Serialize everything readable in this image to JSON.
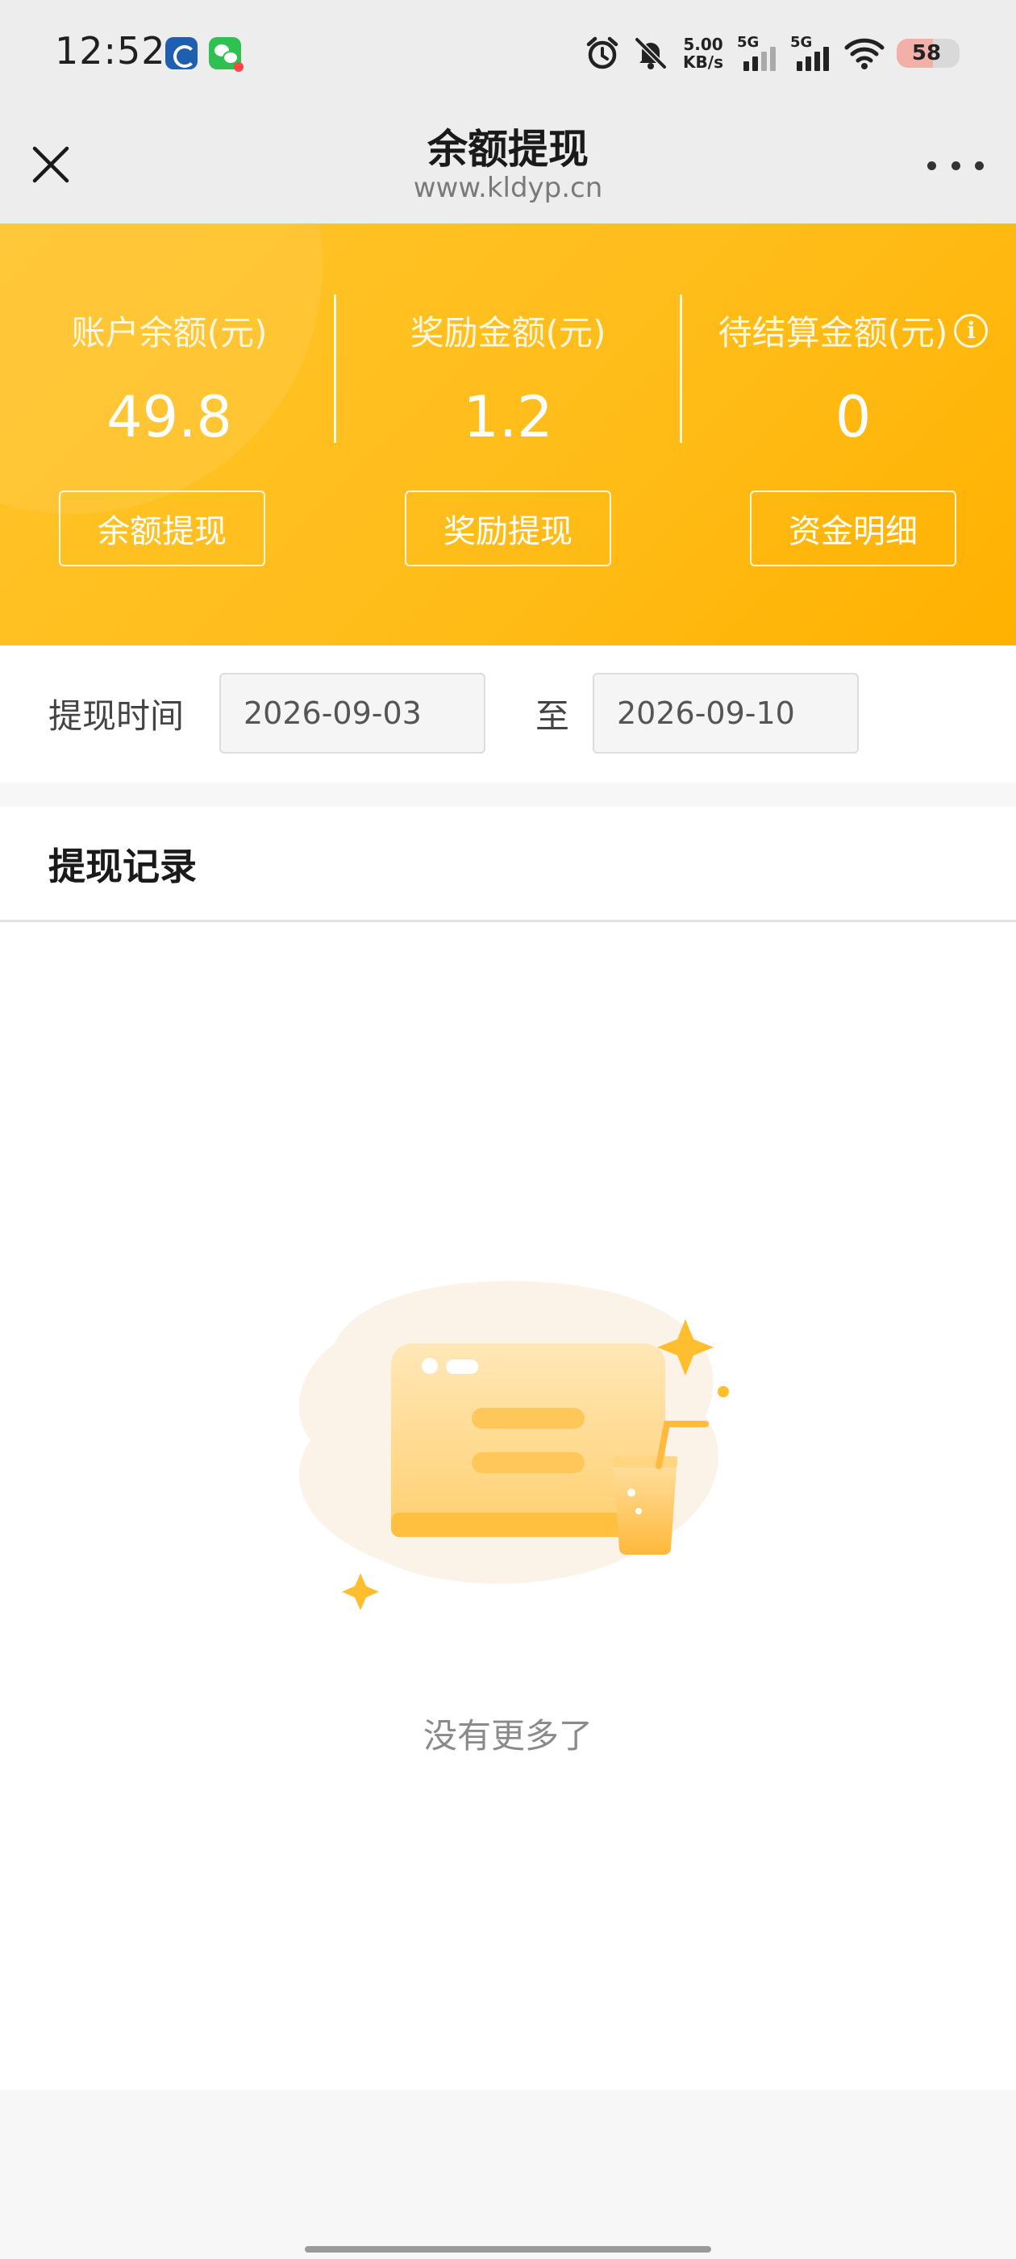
{
  "status_bar": {
    "time": "12:52",
    "net_speed_value": "5.00",
    "net_speed_unit": "KB/s",
    "sim1_label": "5G",
    "sim2_label": "5G",
    "battery": "58",
    "icons": [
      "bank-app-icon",
      "wechat-icon",
      "alarm-icon",
      "mute-icon",
      "wifi-icon",
      "battery-icon"
    ]
  },
  "nav": {
    "title": "余额提现",
    "url": "www.kldyp.cn"
  },
  "summary": {
    "stats": [
      {
        "label": "账户余额(元)",
        "value": "49.8"
      },
      {
        "label": "奖励金额(元)",
        "value": "1.2"
      },
      {
        "label": "待结算金额(元)",
        "value": "0"
      }
    ],
    "info_glyph": "i",
    "buttons": [
      {
        "label": "余额提现"
      },
      {
        "label": "奖励提现"
      },
      {
        "label": "资金明细"
      }
    ]
  },
  "filter": {
    "label": "提现时间",
    "start_date": "2026-09-03",
    "to_label": "至",
    "end_date": "2026-09-10"
  },
  "records": {
    "title": "提现记录",
    "empty_text": "没有更多了"
  },
  "colors": {
    "header_yellow": "#ffbb14",
    "page_bg": "#f7f7f7",
    "nav_bg": "#ededed"
  }
}
